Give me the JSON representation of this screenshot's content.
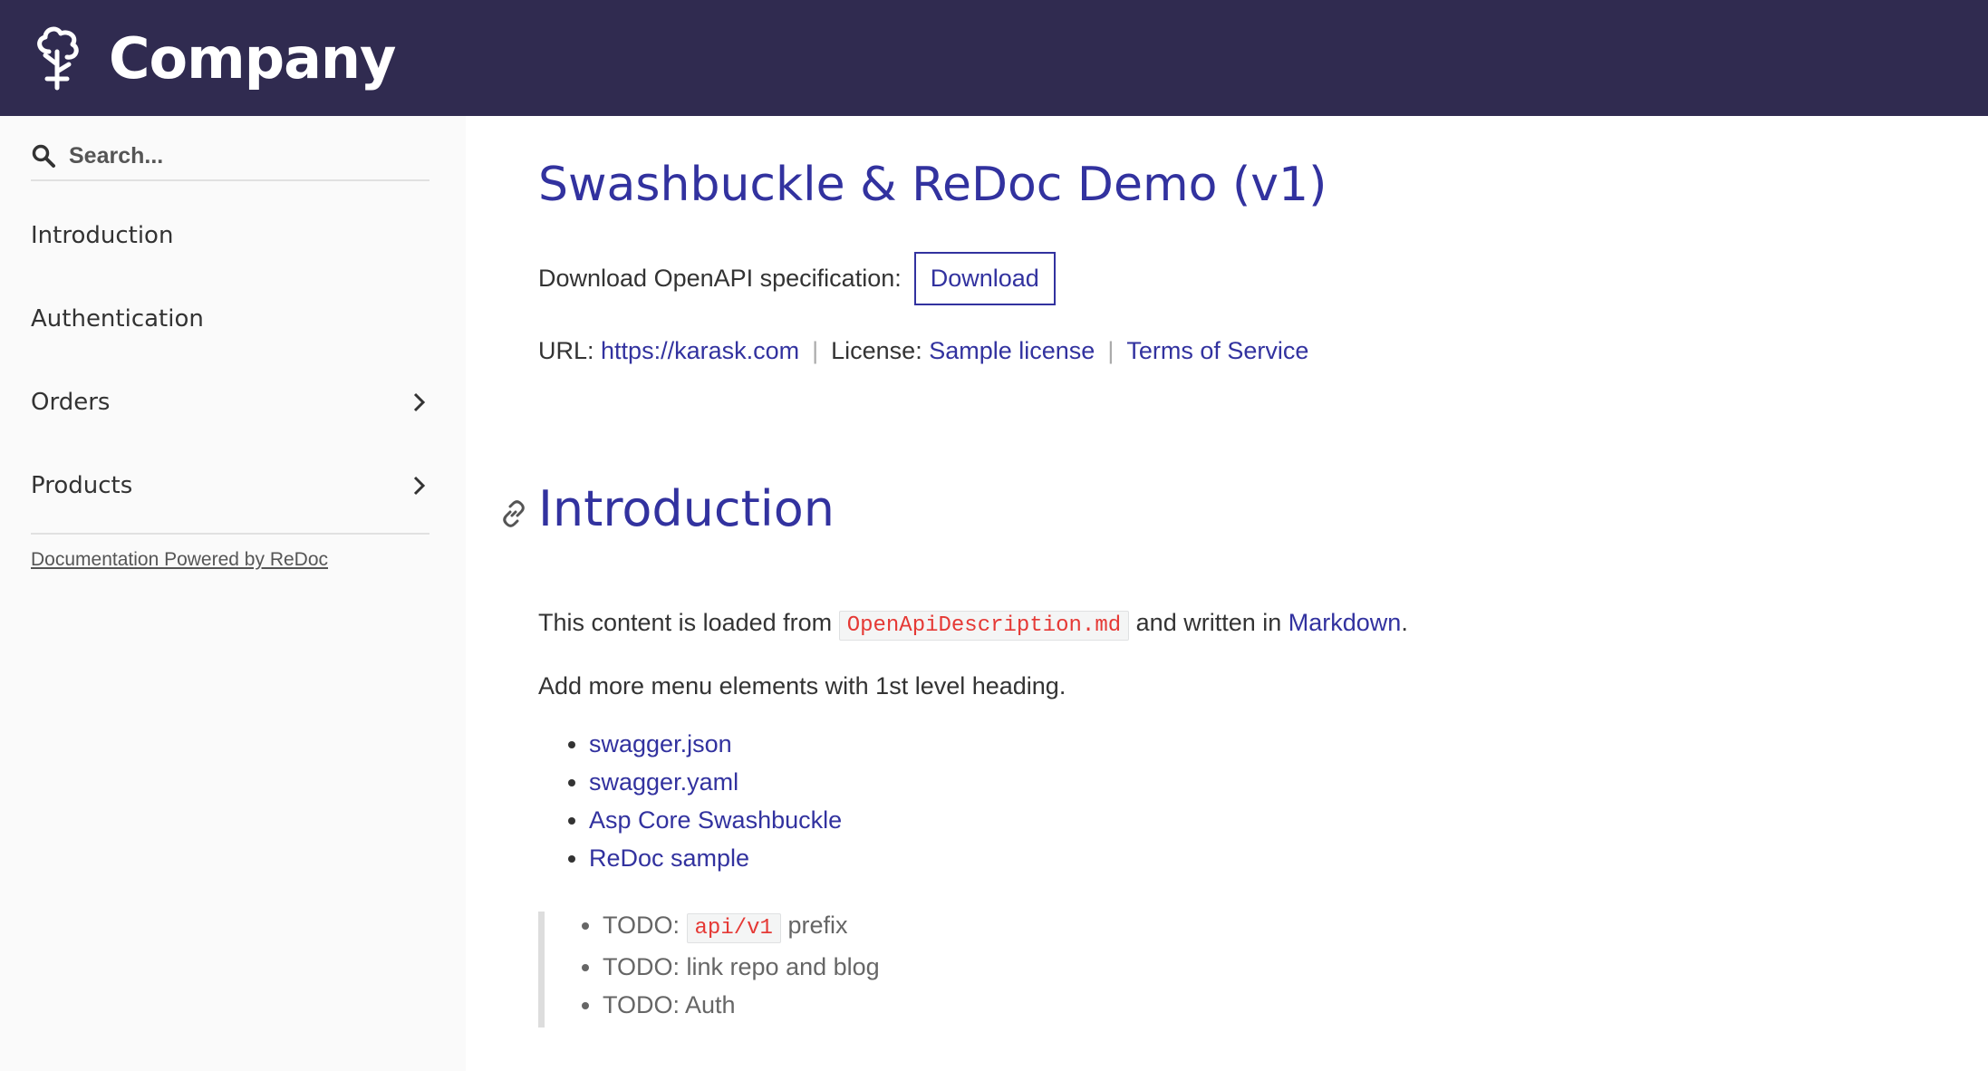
{
  "header": {
    "brand": "Company",
    "logo_icon": "tree-logo-icon",
    "background": "#302b50"
  },
  "sidebar": {
    "search_placeholder": "Search...",
    "items": [
      {
        "label": "Introduction",
        "has_children": false
      },
      {
        "label": "Authentication",
        "has_children": false
      },
      {
        "label": "Orders",
        "has_children": true
      },
      {
        "label": "Products",
        "has_children": true
      }
    ],
    "powered_by": "Documentation Powered by ReDoc"
  },
  "main": {
    "title": "Swashbuckle & ReDoc Demo (v1)",
    "download_label": "Download OpenAPI specification:",
    "download_button": "Download",
    "url_label": "URL:",
    "url_value": "https://karask.com",
    "license_label": "License:",
    "license_value": "Sample license",
    "tos": "Terms of Service",
    "section_title": "Introduction",
    "para1_before": "This content is loaded from",
    "para1_code": "OpenApiDescription.md",
    "para1_mid": "and written in",
    "para1_link": "Markdown",
    "para1_end": ".",
    "para2": "Add more menu elements with 1st level heading.",
    "links": [
      "swagger.json",
      "swagger.yaml",
      "Asp Core Swashbuckle",
      "ReDoc sample"
    ],
    "todo": {
      "item1_before": "TODO:",
      "item1_code": "api/v1",
      "item1_after": "prefix",
      "item2": "TODO: link repo and blog",
      "item3": "TODO: Auth"
    }
  },
  "colors": {
    "accent": "#32329f",
    "code": "#e53935",
    "sidebar_bg": "#fafafa"
  }
}
